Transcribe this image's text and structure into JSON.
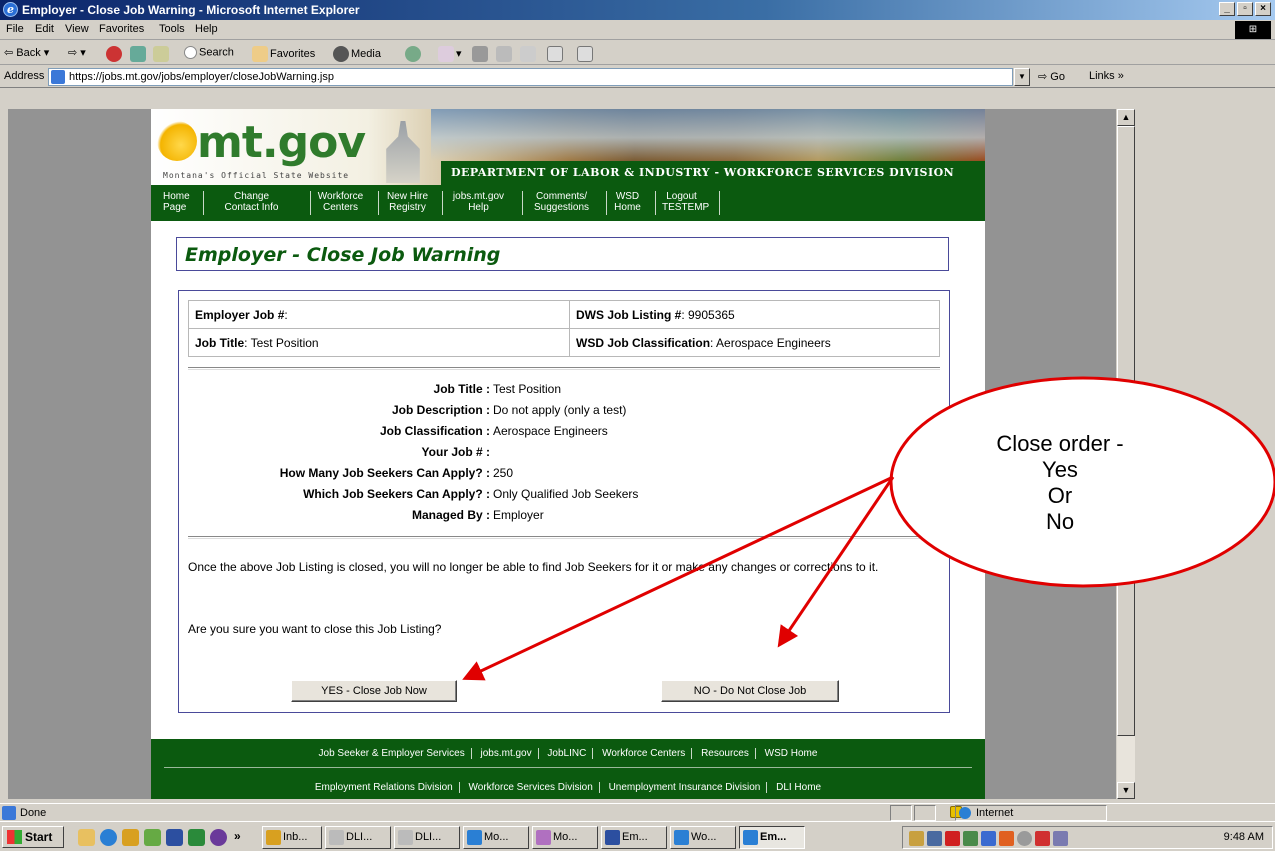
{
  "window": {
    "title": "Employer - Close Job Warning - Microsoft Internet Explorer"
  },
  "menu": [
    "File",
    "Edit",
    "View",
    "Favorites",
    "Tools",
    "Help"
  ],
  "toolbar": {
    "back": "Back",
    "search": "Search",
    "favorites": "Favorites",
    "media": "Media"
  },
  "address": {
    "label": "Address",
    "url": "https://jobs.mt.gov/jobs/employer/closeJobWarning.jsp",
    "go": "Go",
    "links": "Links »"
  },
  "site": {
    "logo": "mt.gov",
    "tagline": "Montana's Official State Website",
    "department": "DEPARTMENT OF LABOR & INDUSTRY - WORKFORCE SERVICES DIVISION",
    "nav": [
      {
        "line1": "Home",
        "line2": "Page"
      },
      {
        "line1": "Change",
        "line2": "Contact Info"
      },
      {
        "line1": "Workforce",
        "line2": "Centers"
      },
      {
        "line1": "New Hire",
        "line2": "Registry"
      },
      {
        "line1": "jobs.mt.gov",
        "line2": "Help"
      },
      {
        "line1": "Comments/",
        "line2": "Suggestions"
      },
      {
        "line1": "WSD",
        "line2": "Home"
      },
      {
        "line1": "Logout",
        "line2": "TESTEMP"
      }
    ]
  },
  "page": {
    "title": "Employer - Close Job Warning",
    "table": {
      "employer_job_label": "Employer Job #",
      "employer_job_value": ":",
      "dws_label": "DWS Job Listing #",
      "dws_value": ": 9905365",
      "job_title_label": "Job Title",
      "job_title_value": ": Test Position",
      "classification_label": "WSD Job Classification",
      "classification_value": ": Aerospace Engineers"
    },
    "details": [
      {
        "label": "Job Title :",
        "value": "Test Position"
      },
      {
        "label": "Job Description :",
        "value": "Do not apply (only a test)"
      },
      {
        "label": "Job Classification :",
        "value": "Aerospace Engineers"
      },
      {
        "label": "Your Job # :",
        "value": ""
      },
      {
        "label": "How Many Job Seekers Can Apply? :",
        "value": "250"
      },
      {
        "label": "Which Job Seekers Can Apply? :",
        "value": "Only Qualified Job Seekers"
      },
      {
        "label": "Managed By :",
        "value": "Employer"
      }
    ],
    "warning": "Once the above Job Listing is closed, you will no longer be able to find Job Seekers for it or make any changes or corrections to it.",
    "confirm": "Are you sure you want to close this Job Listing?",
    "yes_button": "YES - Close Job Now",
    "no_button": "NO - Do Not Close Job"
  },
  "footer": {
    "row1": [
      "Job Seeker & Employer Services",
      "jobs.mt.gov",
      "JobLINC",
      "Workforce Centers",
      "Resources",
      "WSD Home"
    ],
    "row2": [
      "Employment Relations Division",
      "Workforce Services Division",
      "Unemployment Insurance Division",
      "DLI Home"
    ]
  },
  "annotation": {
    "lines": [
      "Close order -",
      "Yes",
      "Or",
      "No"
    ],
    "color": "#e00000"
  },
  "status": {
    "text": "Done",
    "zone": "Internet"
  },
  "taskbar": {
    "start": "Start",
    "tasks": [
      "Inb...",
      "DLI...",
      "DLI...",
      "Mo...",
      "Mo...",
      "Em...",
      "Wo...",
      "Em..."
    ],
    "clock": "9:48 AM"
  }
}
